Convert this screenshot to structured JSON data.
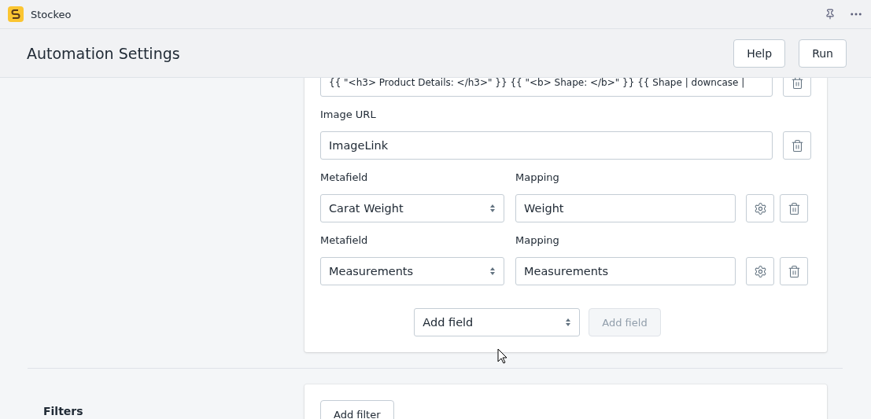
{
  "app_bar": {
    "title": "Stockeo"
  },
  "header": {
    "title": "Automation Settings",
    "buttons": [
      "Help",
      "Run"
    ]
  },
  "mapping_card": {
    "fields": [
      {
        "kind": "text",
        "value": "{{ \"<h3> Product Details: </h3>\" }} {{ \"<b> Shape: </b>\" }} {{ Shape | downcase |"
      },
      {
        "kind": "text",
        "label": "Image URL",
        "value": "ImageLink"
      },
      {
        "kind": "metafield",
        "metafield_label": "Metafield",
        "metafield_value": "Carat Weight",
        "mapping_label": "Mapping",
        "mapping_value": "Weight"
      },
      {
        "kind": "metafield",
        "metafield_label": "Metafield",
        "metafield_value": "Measurements",
        "mapping_label": "Mapping",
        "mapping_value": "Measurements"
      }
    ],
    "add_select": "Add field",
    "add_button": {
      "label": "Add field",
      "disabled": true
    }
  },
  "filters": {
    "title": "Filters",
    "add_button": "Add filter"
  }
}
